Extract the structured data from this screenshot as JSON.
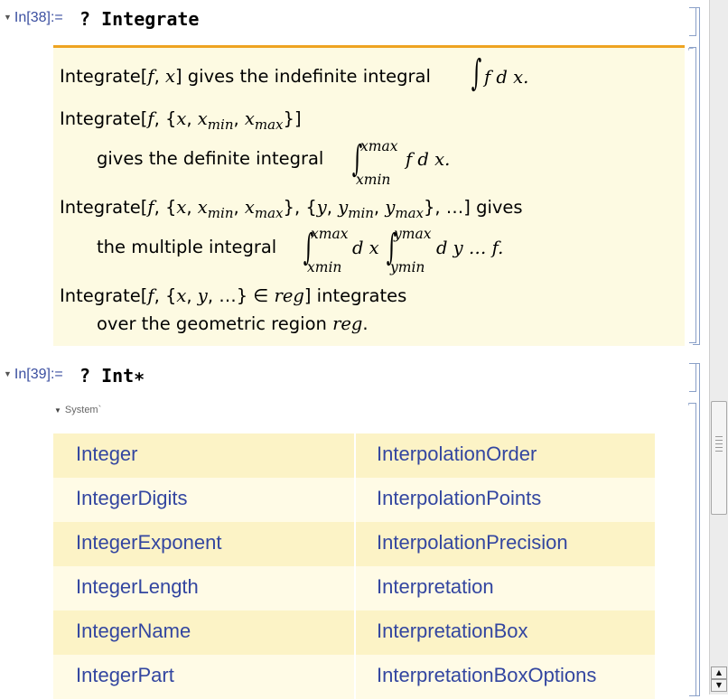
{
  "cells": [
    {
      "label": "In[38]:=",
      "input": "? Integrate"
    },
    {
      "label": "In[39]:=",
      "input": "? Int∗"
    }
  ],
  "info": {
    "l1_pre": "Integrate[",
    "l1_f": "f",
    "l1_comma": ", ",
    "l1_x": "x",
    "l1_close": "] gives the indefinite integral",
    "l1_integrand": "f d x.",
    "l2_pre": "Integrate[",
    "l2_rest_a": "f",
    "l2_rest_b": ", {",
    "l2_x": "x",
    "l2_c1": ", ",
    "l2_xmin": "x",
    "l2_min": "min",
    "l2_c2": ", ",
    "l2_xmax": "x",
    "l2_max": "max",
    "l2_close": "}]",
    "l3_text": "gives the definite integral",
    "l3_upper": "x",
    "l3_upper_sub": "max",
    "l3_lower": "x",
    "l3_lower_sub": "min",
    "l3_integrand": "f d x.",
    "l4_a": "Integrate[",
    "l4_f": "f",
    "l4_b": ", {",
    "l4_x": "x",
    "l4_c": ", ",
    "l4_xmin": "x",
    "l4_min": "min",
    "l4_d": ", ",
    "l4_xmax": "x",
    "l4_max": "max",
    "l4_e": "}, {",
    "l4_y": "y",
    "l4_g": ", ",
    "l4_ymin": "y",
    "l4_ymin_sub": "min",
    "l4_h": ", ",
    "l4_ymax": "y",
    "l4_ymax_sub": "max",
    "l4_i": "}, …] gives",
    "l5_text": "the multiple integral",
    "l5_u1": "x",
    "l5_u1s": "max",
    "l5_l1": "x",
    "l5_l1s": "min",
    "l5_mid": "d x",
    "l5_u2": "y",
    "l5_u2s": "max",
    "l5_l2": "y",
    "l5_l2s": "min",
    "l5_end": "d y … f.",
    "l6_a": "Integrate[",
    "l6_f": "f",
    "l6_b": ", {",
    "l6_x": "x",
    "l6_c": ", ",
    "l6_y": "y",
    "l6_d": ", …} ∈ ",
    "l6_reg": "reg",
    "l6_e": "] integrates",
    "l7_a": "over the geometric region ",
    "l7_reg": "reg",
    "l7_b": "."
  },
  "system_label": "System`",
  "symbols": {
    "left": [
      "Integer",
      "IntegerDigits",
      "IntegerExponent",
      "IntegerLength",
      "IntegerName",
      "IntegerPart"
    ],
    "right": [
      "InterpolationOrder",
      "InterpolationPoints",
      "InterpolationPrecision",
      "Interpretation",
      "InterpretationBox",
      "InterpretationBoxOptions"
    ]
  },
  "icons": {
    "expand": "triangle-down-icon",
    "scroll_up": "arrow-up-icon",
    "scroll_down": "arrow-down-icon"
  },
  "colors": {
    "link": "#3346a0",
    "info_bg": "#fdfae2",
    "info_rule": "#eea321",
    "row_a": "#fcf3c6",
    "row_b": "#fffbe6"
  }
}
